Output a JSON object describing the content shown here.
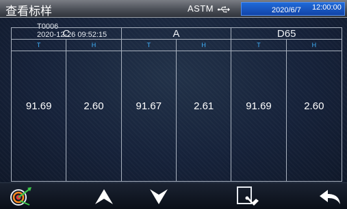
{
  "header": {
    "title": "查看标样",
    "standard": "ASTM",
    "date": "2020/6/7",
    "time": "12:00:00"
  },
  "sample": {
    "id": "T0006",
    "timestamp": "2020-12-26 09:52:15"
  },
  "table": {
    "illuminants": [
      "C",
      "A",
      "D65"
    ],
    "subheaders": [
      "T",
      "H",
      "T",
      "H",
      "T",
      "H"
    ],
    "values": [
      "91.69",
      "2.60",
      "91.67",
      "2.61",
      "91.69",
      "2.60"
    ]
  },
  "toolbar": {
    "icons": [
      "target-icon",
      "arrow-up-icon",
      "arrow-down-icon",
      "select-icon",
      "back-icon"
    ]
  },
  "colors": {
    "accent": "#3fb3ff",
    "date_bg": "#1a57c4"
  }
}
